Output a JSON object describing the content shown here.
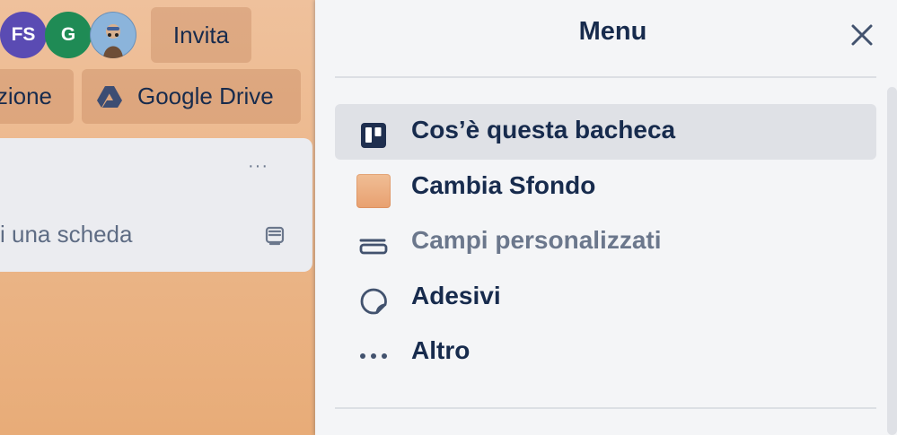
{
  "board": {
    "avatars": [
      {
        "initials": "FS",
        "color": "#5a4bb3"
      },
      {
        "initials": "G",
        "color": "#1f8b55"
      },
      {
        "type": "photo"
      }
    ],
    "invite_label": "Invita",
    "organize_label": "zione",
    "drive_label": "Google Drive",
    "list": {
      "menu_label": "···",
      "add_card_label": "i una scheda"
    }
  },
  "menu": {
    "title": "Menu",
    "items": [
      {
        "label": "Cos’è questa bacheca",
        "icon": "board-icon",
        "active": true
      },
      {
        "label": "Cambia Sfondo",
        "icon": "background-swatch-icon",
        "active": false
      },
      {
        "label": "Campi personalizzati",
        "icon": "custom-fields-icon",
        "active": false,
        "muted": true
      },
      {
        "label": "Adesivi",
        "icon": "sticker-icon",
        "active": false
      },
      {
        "label": "Altro",
        "icon": "more-icon",
        "active": false
      }
    ],
    "colors": {
      "panel_bg": "#f4f5f7",
      "active_bg": "#dfe1e6",
      "text": "#172b4d",
      "muted_text": "#6b778c",
      "board_bg": "#e8ac78"
    }
  }
}
